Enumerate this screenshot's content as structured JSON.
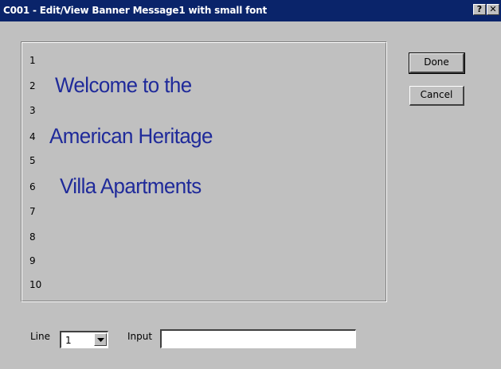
{
  "window": {
    "title": "C001 - Edit/View Banner Message1 with small font",
    "help_label": "?",
    "close_label": "✕"
  },
  "message_lines": [
    {
      "number": "1",
      "text": ""
    },
    {
      "number": "2",
      "text": "Welcome to the"
    },
    {
      "number": "3",
      "text": ""
    },
    {
      "number": "4",
      "text": "American Heritage"
    },
    {
      "number": "5",
      "text": ""
    },
    {
      "number": "6",
      "text": "Villa Apartments"
    },
    {
      "number": "7",
      "text": ""
    },
    {
      "number": "8",
      "text": ""
    },
    {
      "number": "9",
      "text": ""
    },
    {
      "number": "10",
      "text": ""
    }
  ],
  "buttons": {
    "done_label": "Done",
    "cancel_label": "Cancel"
  },
  "controls": {
    "line_label": "Line",
    "line_value": "1",
    "input_label": "Input",
    "input_value": ""
  },
  "colors": {
    "titlebar": "#0a246a",
    "dialog_background": "#c0c0c0",
    "banner_text": "#1f2a9a"
  }
}
